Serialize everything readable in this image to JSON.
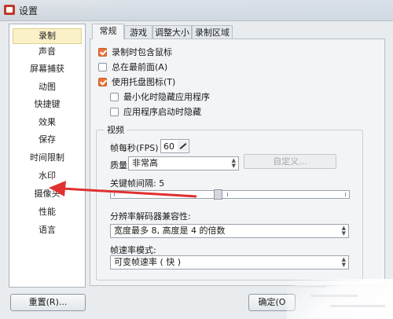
{
  "window": {
    "title": "设置"
  },
  "sidebar": {
    "items": [
      {
        "label": "录制",
        "name": "sidebar-item-record",
        "active": true
      },
      {
        "label": "声音",
        "name": "sidebar-item-sound"
      },
      {
        "label": "屏幕捕获",
        "name": "sidebar-item-screen-capture"
      },
      {
        "label": "动图",
        "name": "sidebar-item-gif"
      },
      {
        "label": "快捷键",
        "name": "sidebar-item-hotkeys"
      },
      {
        "label": "效果",
        "name": "sidebar-item-effects"
      },
      {
        "label": "保存",
        "name": "sidebar-item-save"
      },
      {
        "label": "时间限制",
        "name": "sidebar-item-time-limit"
      },
      {
        "label": "水印",
        "name": "sidebar-item-watermark"
      },
      {
        "label": "摄像头",
        "name": "sidebar-item-camera"
      },
      {
        "label": "性能",
        "name": "sidebar-item-performance"
      },
      {
        "label": "语言",
        "name": "sidebar-item-language"
      }
    ]
  },
  "tabs": [
    {
      "label": "常规",
      "active": true
    },
    {
      "label": "游戏"
    },
    {
      "label": "调整大小"
    },
    {
      "label": "录制区域"
    }
  ],
  "general": {
    "include_cursor": {
      "label": "录制时包含鼠标",
      "checked": true
    },
    "always_on_top": {
      "label": "总在最前面(A)",
      "checked": false
    },
    "tray_icon": {
      "label": "使用托盘图标(T)",
      "checked": true
    },
    "minimize_on_start": {
      "label": "最小化时隐藏应用程序",
      "checked": false
    },
    "hide_on_start": {
      "label": "应用程序启动时隐藏",
      "checked": false
    }
  },
  "video": {
    "group_title": "视频",
    "fps_label": "帧每秒(FPS) :",
    "fps_value": "60",
    "quality_label": "质量:",
    "quality_value": "非常高",
    "custom_button": "自定义...",
    "keyframe_label": "关键帧间隔: 5",
    "keyframe_level": 0.45,
    "resolution_label": "分辨率解码器兼容性:",
    "resolution_value": "宽度最多 8, 高度是 4 的倍数",
    "framerate_label": "帧速率模式:",
    "framerate_value": "可变帧速率 ( 快 )"
  },
  "footer": {
    "reset_label": "重置(R)...",
    "ok_label": "确定(O"
  },
  "colors": {
    "accent": "#e8743b",
    "annotation_arrow": "#e03030",
    "active_item": "#fbf1c9"
  }
}
